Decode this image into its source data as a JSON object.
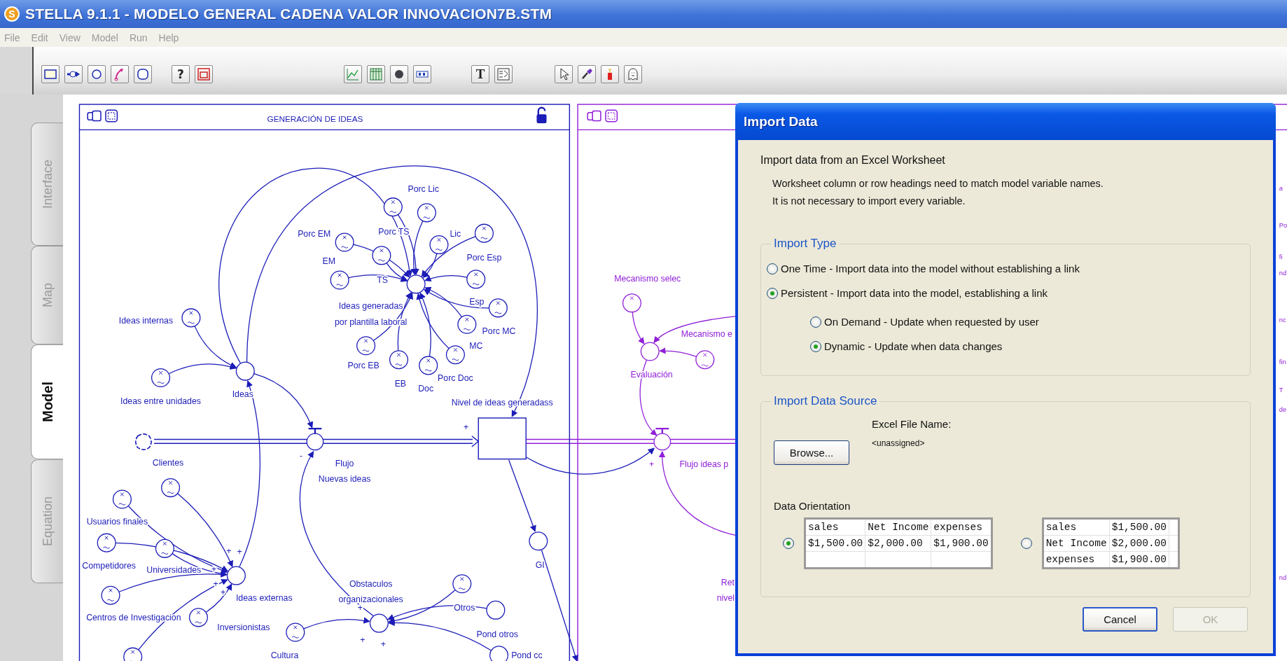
{
  "window": {
    "logo": "S",
    "title": "STELLA 9.1.1 - MODELO GENERAL CADENA VALOR INNOVACION7B.STM"
  },
  "menu": [
    {
      "label": "File",
      "disabled": true
    },
    {
      "label": "Edit",
      "disabled": true
    },
    {
      "label": "View",
      "disabled": true
    },
    {
      "label": "Model",
      "disabled": true
    },
    {
      "label": "Run",
      "disabled": true
    },
    {
      "label": "Help",
      "disabled": true
    }
  ],
  "toolbar": [
    {
      "kind": "stock"
    },
    {
      "kind": "flow"
    },
    {
      "kind": "converter"
    },
    {
      "kind": "connector"
    },
    {
      "kind": "module"
    },
    {
      "kind": "help",
      "label": "?"
    },
    {
      "kind": "sector"
    },
    {
      "kind": "graph"
    },
    {
      "kind": "table"
    },
    {
      "kind": "numeric"
    },
    {
      "kind": "slider"
    },
    {
      "kind": "text",
      "label": "T"
    },
    {
      "kind": "picture"
    },
    {
      "kind": "pointer"
    },
    {
      "kind": "brush"
    },
    {
      "kind": "dynamite"
    },
    {
      "kind": "ghost"
    }
  ],
  "side_tabs": [
    {
      "label": "Interface",
      "selected": false
    },
    {
      "label": "Map",
      "selected": false
    },
    {
      "label": "Model",
      "selected": true
    },
    {
      "label": "Equation",
      "selected": false
    }
  ],
  "diagram": {
    "sectors": [
      {
        "title": "GENERACIÓN DE IDEAS",
        "labels": [
          "Porc Lic",
          "Porc EM",
          "Porc TS",
          "Lic",
          "EM",
          "Porc Esp",
          "TS",
          "Ideas generadas",
          "por plantilla laboral",
          "Esp",
          "Ideas internas",
          "Porc MC",
          "MC",
          "Porc EB",
          "Porc Doc",
          "EB",
          "Doc",
          "Ideas",
          "Ideas entre unidades",
          "Nivel de ideas generadass",
          "+",
          "-",
          "Clientes",
          "Flujo",
          "Nuevas ideas",
          "Usuarios finales",
          "+",
          "+",
          "Competidores",
          "Universidades",
          "+",
          "GI",
          "+",
          "Obstaculos",
          "+",
          "Ideas externas",
          "organizacionales",
          "+",
          "Otros",
          "Centros de Investigacion",
          "Inversionistas",
          "Pond otros",
          "+",
          "+",
          "Cultura",
          "Pond cc"
        ]
      },
      {
        "labels": [
          "Mecanismo selec",
          "Mecanismo e",
          "Evaluación",
          "+",
          "Flujo ideas p",
          "Ret",
          "nivel"
        ]
      }
    ],
    "edge_fragments": [
      "a",
      "Po",
      "fi",
      "nd",
      "nc",
      "fin",
      "T",
      "de",
      "nd"
    ]
  },
  "dialog": {
    "title": "Import Data",
    "heading": "Import data from an Excel Worksheet",
    "notes": [
      "Worksheet column or row headings need to match model variable names.",
      "It is not necessary to import every variable."
    ],
    "import_type": {
      "legend": "Import Type",
      "options": [
        {
          "label": "One Time - Import data into the model without establishing a link",
          "selected": false
        },
        {
          "label": "Persistent - Import data into the model, establishing a link",
          "selected": true,
          "children": [
            {
              "label": "On Demand - Update when requested by user",
              "selected": false
            },
            {
              "label": "Dynamic - Update when data changes",
              "selected": true
            }
          ]
        }
      ]
    },
    "source": {
      "legend": "Import Data Source",
      "file_label": "Excel File Name:",
      "file_name": "<unassigned>",
      "browse": "Browse...",
      "orientation_label": "Data Orientation",
      "orientations": [
        {
          "selected": true,
          "rows": [
            [
              "sales",
              "Net Income",
              "expenses"
            ],
            [
              "$1,500.00",
              "$2,000.00",
              "$1,900.00"
            ]
          ]
        },
        {
          "selected": false,
          "rows": [
            [
              "sales",
              "$1,500.00"
            ],
            [
              "Net Income",
              "$2,000.00"
            ],
            [
              "expenses",
              "$1,900.00"
            ]
          ]
        }
      ]
    },
    "buttons": [
      {
        "label": "Cancel",
        "disabled": false
      },
      {
        "label": "OK",
        "disabled": true
      }
    ]
  }
}
